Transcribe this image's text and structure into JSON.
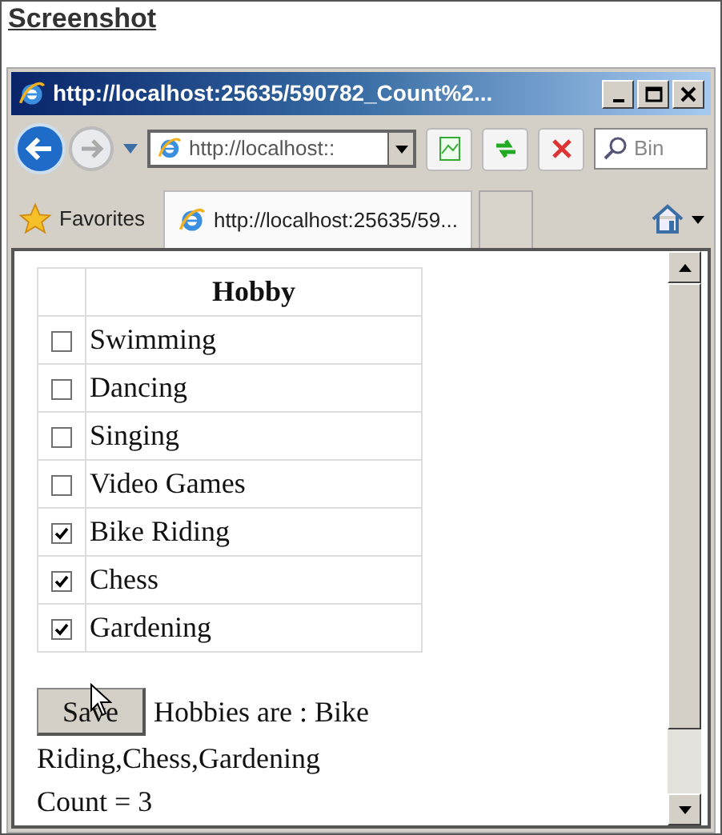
{
  "heading": "Screenshot",
  "window": {
    "title": "http://localhost:25635/590782_Count%2..."
  },
  "toolbar": {
    "address": "http://localhost::",
    "search": {
      "placeholder": "Bin"
    }
  },
  "favorites": "Favorites",
  "tabs": [
    {
      "label": "http://localhost:25635/59...",
      "selected": true
    },
    {
      "selected": false
    }
  ],
  "table": {
    "columns": [
      "Hobby"
    ],
    "rows": [
      {
        "label": "Swimming",
        "checked": false
      },
      {
        "label": "Dancing",
        "checked": false
      },
      {
        "label": "Singing",
        "checked": false
      },
      {
        "label": "Video Games",
        "checked": false
      },
      {
        "label": "Bike Riding",
        "checked": true
      },
      {
        "label": "Chess",
        "checked": true
      },
      {
        "label": "Gardening",
        "checked": true
      }
    ]
  },
  "save_button": "Save",
  "result_lines": [
    "Hobbies are : Bike",
    "Riding,Chess,Gardening"
  ],
  "count": "Count = 3"
}
